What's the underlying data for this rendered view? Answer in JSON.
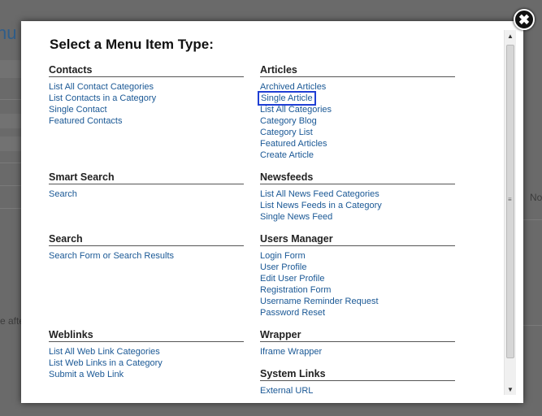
{
  "background": {
    "title_fragment": "nu",
    "left_fragment": "e afte",
    "right_fragment": "No"
  },
  "modal": {
    "title": "Select a Menu Item Type:",
    "close_symbol": "✖"
  },
  "columns": {
    "left": [
      {
        "heading": "Contacts",
        "links": [
          "List All Contact Categories",
          "List Contacts in a Category",
          "Single Contact",
          "Featured Contacts"
        ]
      },
      {
        "heading": "Smart Search",
        "links": [
          "Search"
        ]
      },
      {
        "heading": "Search",
        "links": [
          "Search Form or Search Results"
        ]
      },
      {
        "heading": "Weblinks",
        "links": [
          "List All Web Link Categories",
          "List Web Links in a Category",
          "Submit a Web Link"
        ]
      }
    ],
    "right": [
      {
        "heading": "Articles",
        "links": [
          "Archived Articles",
          "Single Article",
          "List All Categories",
          "Category Blog",
          "Category List",
          "Featured Articles",
          "Create Article"
        ]
      },
      {
        "heading": "Newsfeeds",
        "links": [
          "List All News Feed Categories",
          "List News Feeds in a Category",
          "Single News Feed"
        ]
      },
      {
        "heading": "Users Manager",
        "links": [
          "Login Form",
          "User Profile",
          "Edit User Profile",
          "Registration Form",
          "Username Reminder Request",
          "Password Reset"
        ]
      },
      {
        "heading": "Wrapper",
        "links": [
          "Iframe Wrapper"
        ]
      },
      {
        "heading": "System Links",
        "links": [
          "External URL"
        ]
      }
    ]
  },
  "highlighted_link": "Single Article",
  "colors": {
    "link": "#1a5895",
    "highlight_border": "#1f3fd4"
  },
  "scrollbar": {
    "up_icon": "▲",
    "down_icon": "▼"
  }
}
